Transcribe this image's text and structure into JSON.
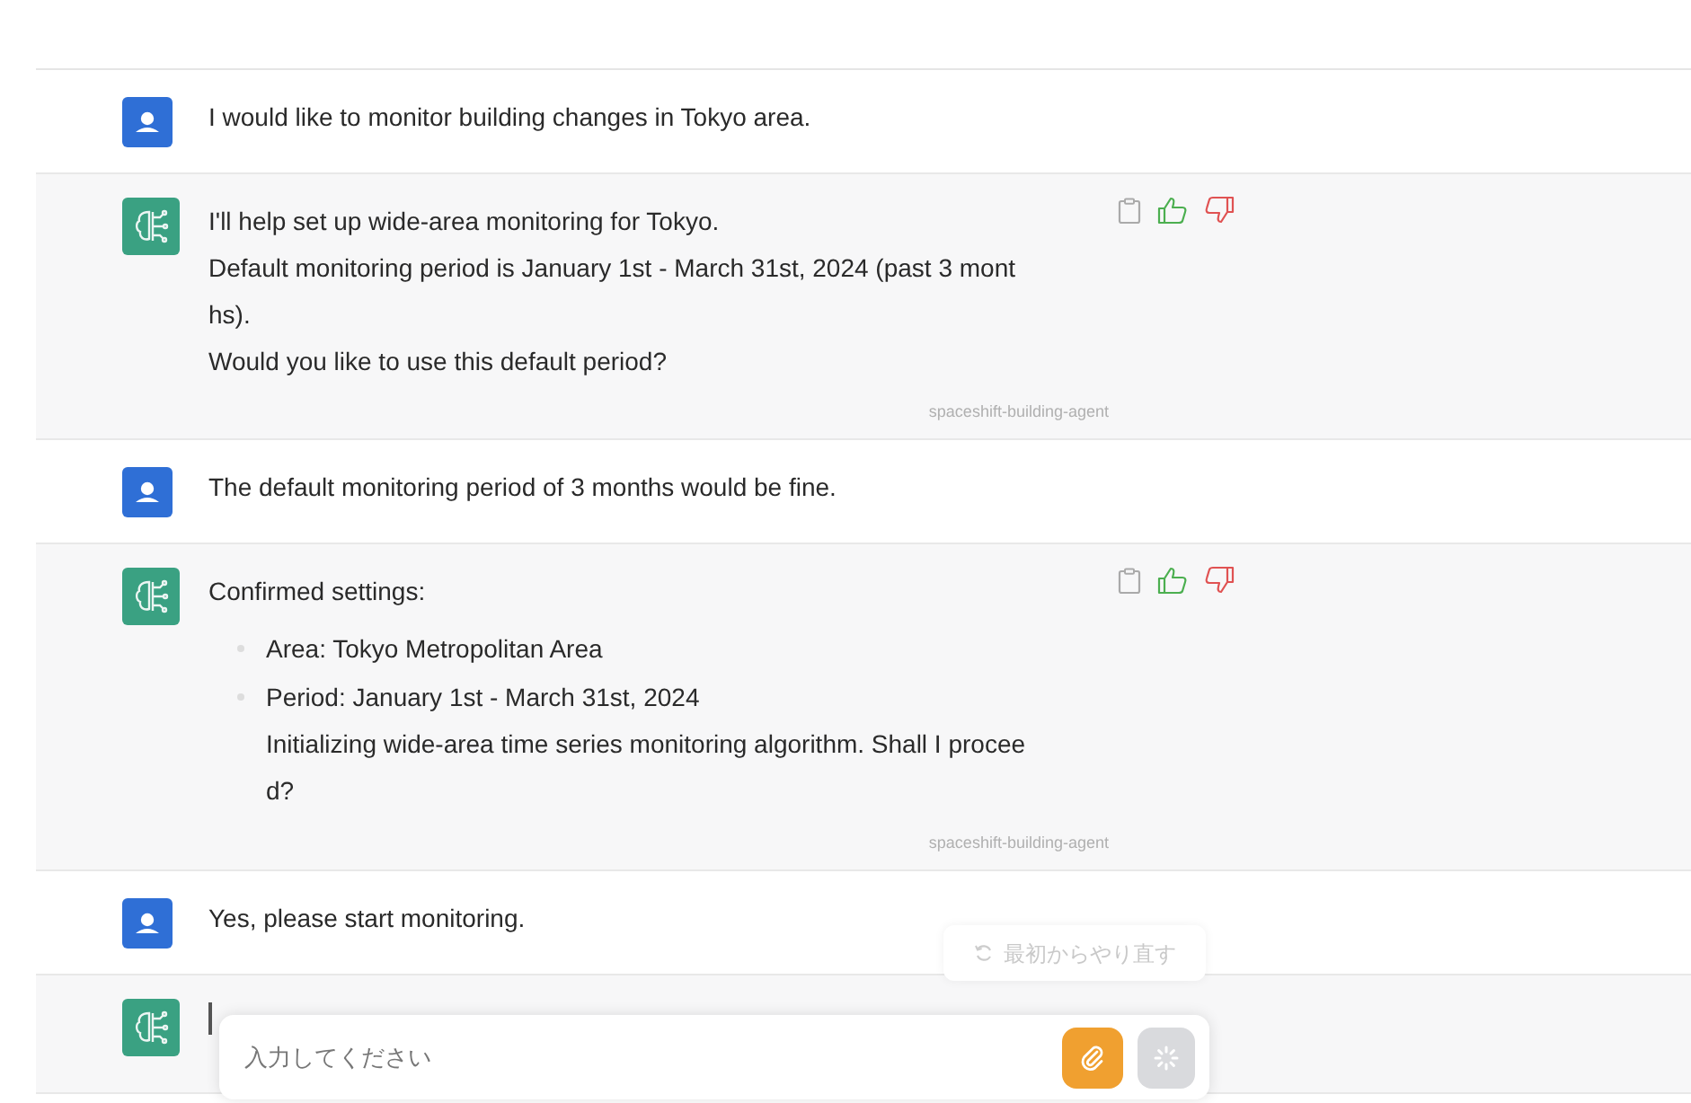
{
  "messages": [
    {
      "kind": "user",
      "lines": [
        "I would like to monitor building changes in Tokyo area."
      ]
    },
    {
      "kind": "assistant",
      "lines": [
        "I'll help set up wide-area monitoring for Tokyo.",
        "Default monitoring period is January 1st - March 31st, 2024 (past 3 mont",
        "hs).",
        "Would you like to use this default period?"
      ],
      "agent": "spaceshift-building-agent"
    },
    {
      "kind": "user",
      "lines": [
        "The default monitoring period of 3 months would be fine."
      ]
    },
    {
      "kind": "assistant",
      "lines": [
        "Confirmed settings:"
      ],
      "bullets": [
        {
          "lines": [
            "Area: Tokyo Metropolitan Area"
          ]
        },
        {
          "lines": [
            "Period: January 1st - March 31st, 2024",
            "Initializing wide-area time series monitoring algorithm. Shall I procee",
            "d?"
          ]
        }
      ],
      "agent": "spaceshift-building-agent"
    },
    {
      "kind": "user",
      "lines": [
        "Yes, please start monitoring."
      ]
    },
    {
      "kind": "assistant",
      "typing": true
    }
  ],
  "restart_button": {
    "label": "最初からやり直す"
  },
  "input": {
    "placeholder": "入力してください",
    "send_disabled": true
  }
}
